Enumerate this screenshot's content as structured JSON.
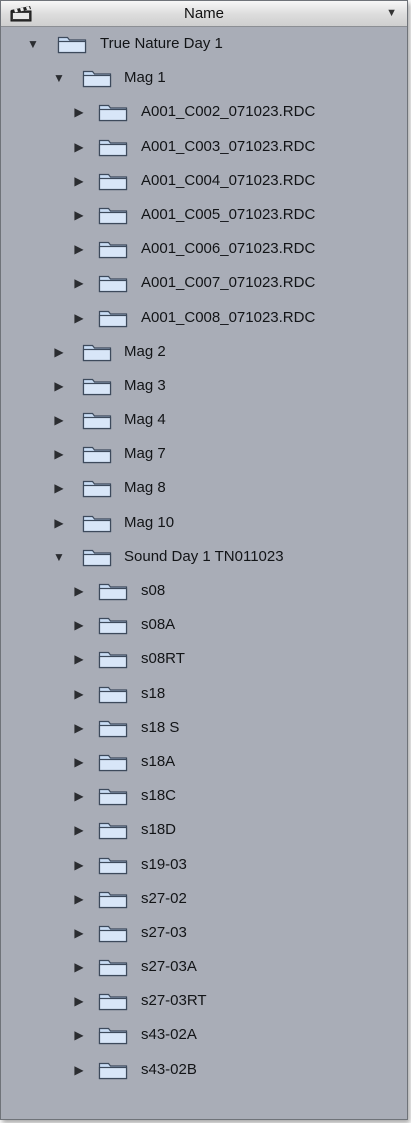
{
  "header": {
    "column_title": "Name",
    "icon": "clapperboard-icon",
    "sort_icon": "triangle-down-icon"
  },
  "colors": {
    "panel": "#a9adb7",
    "folder_fill": "#c9dcf4",
    "folder_stroke": "#3d4a5c"
  },
  "rows": [
    {
      "label": "True Nature Day 1",
      "level": 0,
      "expanded": true
    },
    {
      "label": "Mag 1",
      "level": 1,
      "expanded": true
    },
    {
      "label": "A001_C002_071023.RDC",
      "level": 2,
      "expanded": false
    },
    {
      "label": "A001_C003_071023.RDC",
      "level": 2,
      "expanded": false
    },
    {
      "label": "A001_C004_071023.RDC",
      "level": 2,
      "expanded": false
    },
    {
      "label": "A001_C005_071023.RDC",
      "level": 2,
      "expanded": false
    },
    {
      "label": "A001_C006_071023.RDC",
      "level": 2,
      "expanded": false
    },
    {
      "label": "A001_C007_071023.RDC",
      "level": 2,
      "expanded": false
    },
    {
      "label": "A001_C008_071023.RDC",
      "level": 2,
      "expanded": false
    },
    {
      "label": "Mag 2",
      "level": 1,
      "expanded": false
    },
    {
      "label": "Mag 3",
      "level": 1,
      "expanded": false
    },
    {
      "label": "Mag 4",
      "level": 1,
      "expanded": false
    },
    {
      "label": "Mag 7",
      "level": 1,
      "expanded": false
    },
    {
      "label": "Mag 8",
      "level": 1,
      "expanded": false
    },
    {
      "label": "Mag 10",
      "level": 1,
      "expanded": false
    },
    {
      "label": "Sound Day 1 TN011023",
      "level": 1,
      "expanded": true
    },
    {
      "label": "s08",
      "level": 2,
      "expanded": false
    },
    {
      "label": "s08A",
      "level": 2,
      "expanded": false
    },
    {
      "label": "s08RT",
      "level": 2,
      "expanded": false
    },
    {
      "label": "s18",
      "level": 2,
      "expanded": false
    },
    {
      "label": "s18 S",
      "level": 2,
      "expanded": false
    },
    {
      "label": "s18A",
      "level": 2,
      "expanded": false
    },
    {
      "label": "s18C",
      "level": 2,
      "expanded": false
    },
    {
      "label": "s18D",
      "level": 2,
      "expanded": false
    },
    {
      "label": "s19-03",
      "level": 2,
      "expanded": false
    },
    {
      "label": "s27-02",
      "level": 2,
      "expanded": false
    },
    {
      "label": "s27-03",
      "level": 2,
      "expanded": false
    },
    {
      "label": "s27-03A",
      "level": 2,
      "expanded": false
    },
    {
      "label": "s27-03RT",
      "level": 2,
      "expanded": false
    },
    {
      "label": "s43-02A",
      "level": 2,
      "expanded": false
    },
    {
      "label": "s43-02B",
      "level": 2,
      "expanded": false
    }
  ]
}
